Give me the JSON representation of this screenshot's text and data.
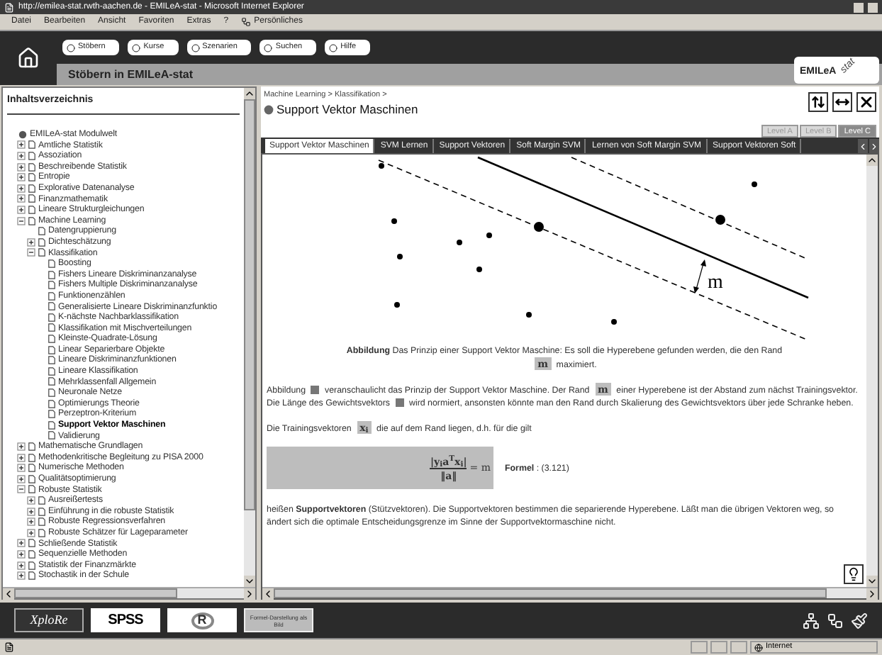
{
  "window": {
    "title": "http://emilea-stat.rwth-aachen.de - EMILeA-stat - Microsoft Internet Explorer"
  },
  "menu": [
    "Datei",
    "Bearbeiten",
    "Ansicht",
    "Favoriten",
    "Extras",
    "?"
  ],
  "links_button": "Persönliches",
  "nav": {
    "buttons": [
      "Stöbern",
      "Kurse",
      "Szenarien",
      "Suchen",
      "Hilfe"
    ],
    "section_title": "Stöbern in EMILeA-stat",
    "logo": "EMILeA",
    "logo_suffix": "stat"
  },
  "toc": {
    "title": "Inhaltsverzeichnis",
    "items": [
      {
        "label": "EMILeA-stat Modulwelt",
        "kind": "root",
        "selected": false,
        "children": [
          {
            "label": "Amtliche Statistik",
            "kind": "page",
            "expanded": false,
            "selected": false
          },
          {
            "label": "Assoziation",
            "kind": "page",
            "expanded": false,
            "selected": false
          },
          {
            "label": "Beschreibende Statistik",
            "kind": "page",
            "expanded": false,
            "selected": false
          },
          {
            "label": "Entropie",
            "kind": "page",
            "expanded": false,
            "selected": false
          },
          {
            "label": "Explorative Datenanalyse",
            "kind": "page",
            "expanded": false,
            "selected": false
          },
          {
            "label": "Finanzmathematik",
            "kind": "page",
            "expanded": false,
            "selected": false
          },
          {
            "label": "Lineare Strukturgleichungen",
            "kind": "page",
            "expanded": false,
            "selected": false
          },
          {
            "label": "Machine Learning",
            "kind": "page",
            "expanded": true,
            "selected": false,
            "children": [
              {
                "label": "Datengruppierung",
                "kind": "page",
                "selected": false
              },
              {
                "label": "Dichteschätzung",
                "kind": "page",
                "expanded": false,
                "selected": false
              },
              {
                "label": "Klassifikation",
                "kind": "page",
                "expanded": true,
                "selected": false,
                "children": [
                  {
                    "label": "Boosting",
                    "kind": "page",
                    "selected": false
                  },
                  {
                    "label": "Fishers Lineare Diskriminanzanalyse",
                    "kind": "page",
                    "selected": false
                  },
                  {
                    "label": "Fishers Multiple Diskriminanzanalyse",
                    "kind": "page",
                    "selected": false
                  },
                  {
                    "label": "Funktionenzählen",
                    "kind": "page",
                    "selected": false
                  },
                  {
                    "label": "Generalisierte Lineare Diskriminanzfunktio",
                    "kind": "page",
                    "selected": false
                  },
                  {
                    "label": "K-nächste Nachbarklassifikation",
                    "kind": "page",
                    "selected": false
                  },
                  {
                    "label": "Klassifikation mit Mischverteilungen",
                    "kind": "page",
                    "selected": false
                  },
                  {
                    "label": "Kleinste-Quadrate-Lösung",
                    "kind": "page",
                    "selected": false
                  },
                  {
                    "label": "Linear Separierbare Objekte",
                    "kind": "page",
                    "selected": false
                  },
                  {
                    "label": "Lineare Diskriminanzfunktionen",
                    "kind": "page",
                    "selected": false
                  },
                  {
                    "label": "Lineare Klassifikation",
                    "kind": "page",
                    "selected": false
                  },
                  {
                    "label": "Mehrklassenfall Allgemein",
                    "kind": "page",
                    "selected": false
                  },
                  {
                    "label": "Neuronale Netze",
                    "kind": "page",
                    "selected": false
                  },
                  {
                    "label": "Optimierungs Theorie",
                    "kind": "page",
                    "selected": false
                  },
                  {
                    "label": "Perzeptron-Kriterium",
                    "kind": "page",
                    "selected": false
                  },
                  {
                    "label": "Support Vektor Maschinen",
                    "kind": "page",
                    "selected": true
                  },
                  {
                    "label": "Validierung",
                    "kind": "page",
                    "selected": false
                  }
                ]
              }
            ]
          },
          {
            "label": "Mathematische Grundlagen",
            "kind": "page",
            "expanded": false,
            "selected": false
          },
          {
            "label": "Methodenkritische Begleitung zu PISA 2000",
            "kind": "page",
            "expanded": false,
            "selected": false
          },
          {
            "label": "Numerische Methoden",
            "kind": "page",
            "expanded": false,
            "selected": false
          },
          {
            "label": "Qualitätsoptimierung",
            "kind": "page",
            "expanded": false,
            "selected": false
          },
          {
            "label": "Robuste Statistik",
            "kind": "page",
            "expanded": true,
            "selected": false,
            "children": [
              {
                "label": "Ausreißertests",
                "kind": "page",
                "expanded": false,
                "selected": false
              },
              {
                "label": "Einführung in die robuste Statistik",
                "kind": "page",
                "expanded": false,
                "selected": false
              },
              {
                "label": "Robuste Regressionsverfahren",
                "kind": "page",
                "expanded": false,
                "selected": false
              },
              {
                "label": "Robuste Schätzer für Lageparameter",
                "kind": "page",
                "expanded": false,
                "selected": false
              }
            ]
          },
          {
            "label": "Schließende Statistik",
            "kind": "page",
            "expanded": false,
            "selected": false
          },
          {
            "label": "Sequenzielle Methoden",
            "kind": "page",
            "expanded": false,
            "selected": false
          },
          {
            "label": "Statistik der Finanzmärkte",
            "kind": "page",
            "expanded": false,
            "selected": false
          },
          {
            "label": "Stochastik in der Schule",
            "kind": "page",
            "expanded": false,
            "selected": false
          }
        ]
      }
    ]
  },
  "content": {
    "breadcrumb": "Machine Learning > Klassifikation >",
    "title": "Support Vektor Maschinen",
    "levels": [
      {
        "label": "Level A",
        "selected": false
      },
      {
        "label": "Level B",
        "selected": false
      },
      {
        "label": "Level C",
        "selected": true
      }
    ],
    "tabs": [
      {
        "label": "Support Vektor Maschinen",
        "selected": true
      },
      {
        "label": "SVM Lernen",
        "selected": false
      },
      {
        "label": "Support Vektoren",
        "selected": false
      },
      {
        "label": "Soft Margin SVM",
        "selected": false
      },
      {
        "label": "Lernen von Soft Margin SVM",
        "selected": false
      },
      {
        "label": "Support Vektoren Soft",
        "selected": false
      }
    ],
    "figure": {
      "margin_label": "m"
    },
    "caption": [
      {
        "kind": "text",
        "text": "**Abbildung** Das Prinzip einer Support Vektor Maschine: Es soll die Hyperebene gefunden werden, die den Rand"
      },
      {
        "kind": "symbol",
        "text": "m"
      },
      {
        "kind": "text",
        "text": "maximiert."
      }
    ],
    "paragraphs": [
      [
        {
          "kind": "text",
          "text": "Abbildung"
        },
        {
          "kind": "figref"
        },
        {
          "kind": "text",
          "text": "veranschaulicht das Prinzip der Support Vektor Maschine. Der Rand"
        },
        {
          "kind": "symbol",
          "text": "m"
        },
        {
          "kind": "text",
          "text": "einer Hyperebene ist der Abstand zum nächst Trainingsvektor. Die Länge des Gewichtsvektors"
        },
        {
          "kind": "figref"
        },
        {
          "kind": "text",
          "text": "wird normiert, ansonsten könnte man den Rand durch Skalierung des Gewichtsvektors über jede Schranke heben."
        }
      ],
      [
        {
          "kind": "text",
          "text": "Die Trainingsvektoren"
        },
        {
          "kind": "symbol",
          "text": "x$_{i}$"
        },
        {
          "kind": "text",
          "text": "die auf dem Rand liegen, d.h. für die gilt"
        }
      ]
    ],
    "formula": {
      "numerator": "|y$_{i}$a$^{T}$x$_{i}$|",
      "denominator": "‖a‖",
      "rhs": "= m",
      "label": "**Formel** : (3.121)"
    },
    "closing": "heißen **Supportvektoren** (Stützvektoren). Die Supportvektoren bestimmen die separierende Hyperebene. Läßt man die übrigen Vektoren weg, so ändert sich die optimale Entscheidungsgrenze im Sinne der Supportvektormaschine nicht."
  },
  "tools": {
    "xplore": "XploRe",
    "spss": "SPSS",
    "r": "R",
    "formula_button": "Formel-Darstellung als Bild"
  },
  "status": {
    "zone": "Internet"
  }
}
